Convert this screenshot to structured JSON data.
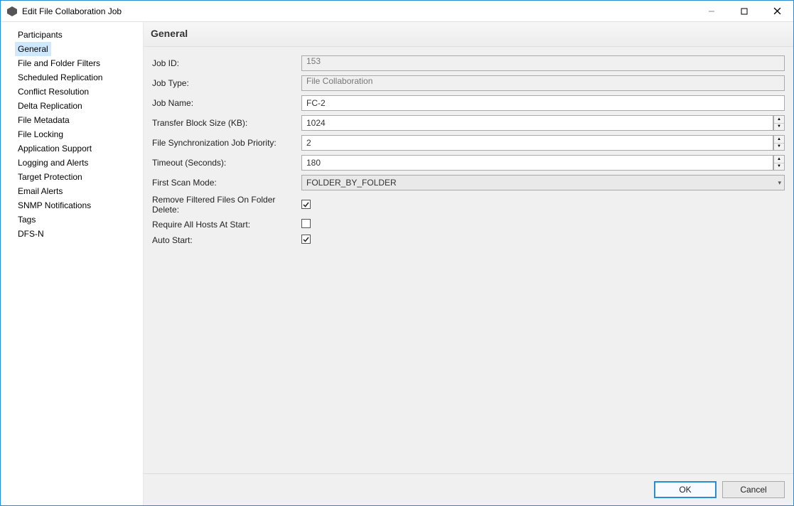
{
  "title": "Edit File Collaboration Job",
  "sidebar": {
    "items": [
      "Participants",
      "General",
      "File and Folder Filters",
      "Scheduled Replication",
      "Conflict Resolution",
      "Delta Replication",
      "File Metadata",
      "File Locking",
      "Application Support",
      "Logging and Alerts",
      "Target Protection",
      "Email Alerts",
      "SNMP Notifications",
      "Tags",
      "DFS-N"
    ],
    "selected_index": 1
  },
  "main": {
    "header": "General",
    "fields": {
      "job_id": {
        "label": "Job ID:",
        "value": "153"
      },
      "job_type": {
        "label": "Job Type:",
        "value": "File Collaboration"
      },
      "job_name": {
        "label": "Job Name:",
        "value": "FC-2"
      },
      "block_size": {
        "label": "Transfer Block Size (KB):",
        "value": "1024"
      },
      "priority": {
        "label": "File Synchronization Job Priority:",
        "value": "2"
      },
      "timeout": {
        "label": "Timeout (Seconds):",
        "value": "180"
      },
      "scan_mode": {
        "label": "First Scan Mode:",
        "value": "FOLDER_BY_FOLDER"
      },
      "remove_filtered": {
        "label": "Remove Filtered Files On Folder Delete:",
        "checked": true
      },
      "require_hosts": {
        "label": "Require All Hosts At Start:",
        "checked": false
      },
      "auto_start": {
        "label": "Auto Start:",
        "checked": true
      }
    }
  },
  "footer": {
    "ok": "OK",
    "cancel": "Cancel"
  }
}
